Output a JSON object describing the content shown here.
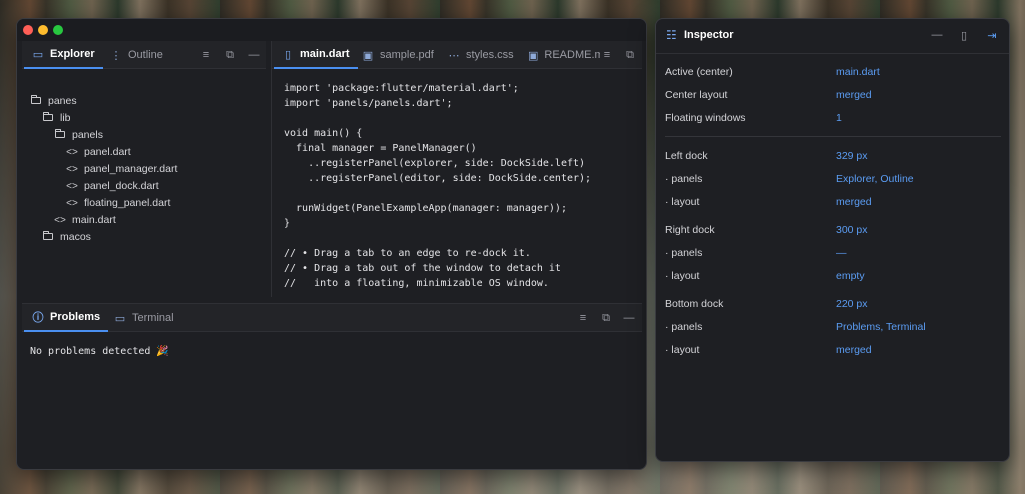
{
  "main_window": {
    "explorer": {
      "tabs": [
        {
          "label": "Explorer",
          "icon": "folder-icon",
          "active": true
        },
        {
          "label": "Outline",
          "icon": "outline-icon",
          "active": false
        }
      ],
      "tree": [
        {
          "label": "panes",
          "type": "folder"
        },
        {
          "label": "lib",
          "type": "folder"
        },
        {
          "label": "panels",
          "type": "folder"
        },
        {
          "label": "panel.dart",
          "type": "file"
        },
        {
          "label": "panel_manager.dart",
          "type": "file"
        },
        {
          "label": "panel_dock.dart",
          "type": "file"
        },
        {
          "label": "floating_panel.dart",
          "type": "file"
        },
        {
          "label": "main.dart",
          "type": "file"
        },
        {
          "label": "macos",
          "type": "folder"
        }
      ]
    },
    "editor": {
      "tabs": [
        {
          "label": "main.dart",
          "icon": "file-icon",
          "active": true
        },
        {
          "label": "sample.pdf",
          "icon": "image-icon",
          "active": false
        },
        {
          "label": "styles.css",
          "icon": "code-icon",
          "active": false
        },
        {
          "label": "README.m",
          "icon": "image-icon",
          "active": false
        }
      ],
      "code_lines": [
        "import 'package:flutter/material.dart';",
        "import 'panels/panels.dart';",
        "",
        "void main() {",
        "  final manager = PanelManager()",
        "    ..registerPanel(explorer, side: DockSide.left)",
        "    ..registerPanel(editor, side: DockSide.center);",
        "",
        "  runWidget(PanelExampleApp(manager: manager));",
        "}",
        "",
        "// • Drag a tab to an edge to re-dock it.",
        "// • Drag a tab out of the window to detach it",
        "//   into a floating, minimizable OS window."
      ]
    },
    "bottom": {
      "tabs": [
        {
          "label": "Problems",
          "icon": "info-icon",
          "active": true
        },
        {
          "label": "Terminal",
          "icon": "terminal-icon",
          "active": false
        }
      ],
      "problems_text": "No problems detected 🎉"
    }
  },
  "inspector": {
    "title": "Inspector",
    "rows": [
      {
        "key": "Active (center)",
        "value": "main.dart"
      },
      {
        "key": "Center layout",
        "value": "merged"
      },
      {
        "key": "Floating windows",
        "value": "1"
      },
      {
        "key": "Left dock",
        "value": "329 px"
      },
      {
        "key": "· panels",
        "value": "Explorer, Outline"
      },
      {
        "key": "· layout",
        "value": "merged"
      },
      {
        "key": "Right dock",
        "value": "300 px"
      },
      {
        "key": "· panels",
        "value": "—"
      },
      {
        "key": "· layout",
        "value": "empty"
      },
      {
        "key": "Bottom dock",
        "value": "220 px"
      },
      {
        "key": "· panels",
        "value": "Problems, Terminal"
      },
      {
        "key": "· layout",
        "value": "merged"
      }
    ]
  },
  "colors": {
    "accent": "#4a8ff0",
    "value_text": "#5b9cf2",
    "window_bg": "#1e1f23"
  }
}
